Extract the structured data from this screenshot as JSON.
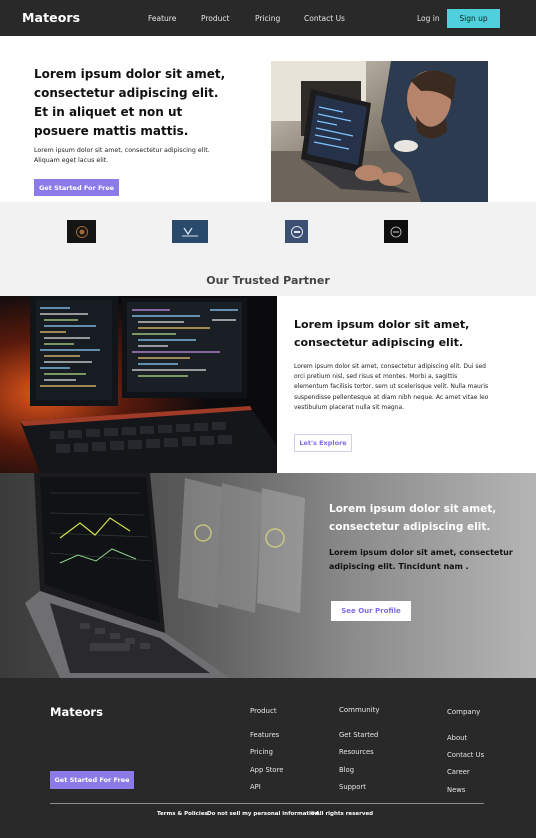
{
  "nav": {
    "brand": "Mateors",
    "links": [
      "Feature",
      "Product",
      "Pricing",
      "Contact Us"
    ],
    "login": "Log in",
    "signup": "Sign up"
  },
  "hero": {
    "title": "Lorem ipsum dolor sit amet, consectetur adipiscing elit. Et in aliquet et non ut posuere mattis mattis.",
    "subtitle": "Lorem ipsum dolor sit amet, consectetur adipiscing elit. Aliquam eget lacus elit.",
    "cta": "Get Started For Free",
    "image": "person-typing-on-laptop-photo"
  },
  "partners": {
    "title": "Our Trusted Partner",
    "logos": [
      "partner-logo-1",
      "partner-logo-2",
      "partner-logo-3",
      "partner-logo-4"
    ]
  },
  "feature": {
    "title": "Lorem ipsum dolor sit amet, consectetur adipiscing elit.",
    "body": "Lorem ipsum dolor sit amet, consectetur adipiscing elit. Dui sed orci pretium nisl, sed risus et montes. Morbi a, sagittis elementum facilisis tortor, sem ut scelerisque velit. Nulla mauris suspendisse pellentesque at diam nibh neque. Ac amet vitae leo vestibulum placerat nulla sit magna.",
    "cta": "Let's Explore",
    "image": "code-monitors-keyboard-photo"
  },
  "profile": {
    "title": "Lorem ipsum dolor sit amet, consectetur adipiscing elit.",
    "subtitle": "Lorem ipsum dolor sit amet, consectetur adipiscing elit. Tincidunt nam .",
    "cta": "See Our Profile",
    "image": "laptop-dashboard-render"
  },
  "footer": {
    "brand": "Mateors",
    "cta": "Get Started For Free",
    "columns": [
      {
        "heading": "Product",
        "items": [
          "Features",
          "Pricing",
          "App Store",
          "API"
        ]
      },
      {
        "heading": "Community",
        "items": [
          "Get Started",
          "Resources",
          "Blog",
          "Support"
        ]
      },
      {
        "heading": "Company",
        "items": [
          "About",
          "Contact Us",
          "Career",
          "News"
        ]
      }
    ],
    "legal": [
      "Terms & Policies",
      "Do not sell my personal information",
      "©All rights reserved"
    ]
  },
  "colors": {
    "dark": "#292929",
    "accent_cyan": "#4fd1dd",
    "accent_purple": "#8b7be8",
    "light_gray": "#f3f2f2"
  }
}
